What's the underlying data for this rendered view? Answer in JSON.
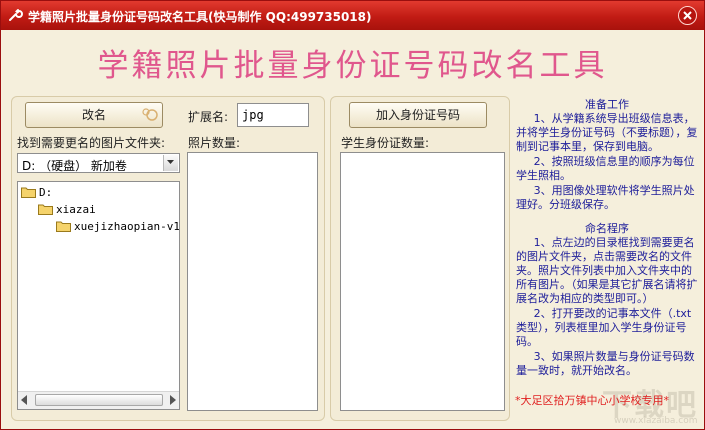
{
  "window": {
    "title": "学籍照片批量身份证号码改名工具(快马制作   QQ:499735018)"
  },
  "heading": "学籍照片批量身份证号码改名工具",
  "left_panel": {
    "rename_button": "改名",
    "folder_label": "找到需要更名的图片文件夹:",
    "drive_selected": "D: （硬盘） 新加卷",
    "tree": [
      "D:",
      "xiazai",
      "xuejizhaopian-v1"
    ]
  },
  "ext": {
    "label": "扩展名:",
    "value": "jpg"
  },
  "photo_count_label": "照片数量:",
  "right_panel": {
    "add_id_button": "加入身份证号码",
    "id_count_label": "学生身份证数量:"
  },
  "instructions": {
    "prep_title": "准备工作",
    "prep": [
      "1、从学籍系统导出班级信息表，并将学生身份证号码（不要标题），复制到记事本里，保存到电脑。",
      "2、按照班级信息里的顺序为每位学生照相。",
      "3、用图像处理软件将学生照片处理好。分班级保存。"
    ],
    "naming_title": "命名程序",
    "naming": [
      "1、点左边的目录框找到需要更名的图片文件夹，点击需要改名的文件夹。照片文件列表中加入文件夹中的所有图片。（如果是其它扩展名请将扩展名改为相应的类型即可。）",
      "2、打开要改的记事本文件（.txt类型），列表框里加入学生身份证号码。",
      "3、如果照片数量与身份证号码数量一致时，就开始改名。"
    ],
    "footer": "*大足区拾万镇中心小学校专用*"
  },
  "watermark": {
    "main": "下载吧",
    "sub": "www.xiazaiba.com"
  },
  "colors": {
    "title_bar": "#c11b14",
    "heading": "#e0578d",
    "instructions": "#1d1d9a",
    "footer": "#e02020",
    "background": "#f5efdc"
  },
  "icons": [
    "wrench-icon",
    "close-icon",
    "folder-icon",
    "chevron-down-icon",
    "button-ornament-icon"
  ]
}
